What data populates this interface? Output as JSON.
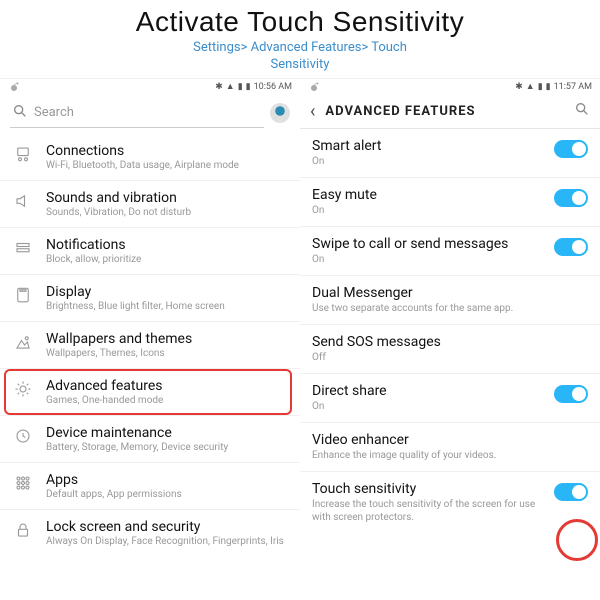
{
  "header": {
    "title": "Activate Touch Sensitivity",
    "breadcrumb_line1": "Settings> Advanced Features> Touch",
    "breadcrumb_line2": "Sensitivity"
  },
  "status_left": {
    "time": "10:56 AM"
  },
  "status_right": {
    "time": "11:57 AM"
  },
  "search_placeholder": "Search",
  "settings": [
    {
      "title": "Connections",
      "sub": "Wi-Fi, Bluetooth, Data usage, Airplane mode",
      "icon": "connections"
    },
    {
      "title": "Sounds and vibration",
      "sub": "Sounds, Vibration, Do not disturb",
      "icon": "sound"
    },
    {
      "title": "Notifications",
      "sub": "Block, allow, prioritize",
      "icon": "notifications"
    },
    {
      "title": "Display",
      "sub": "Brightness, Blue light filter, Home screen",
      "icon": "display"
    },
    {
      "title": "Wallpapers and themes",
      "sub": "Wallpapers, Themes, Icons",
      "icon": "wallpaper"
    },
    {
      "title": "Advanced features",
      "sub": "Games, One-handed mode",
      "icon": "advanced"
    },
    {
      "title": "Device maintenance",
      "sub": "Battery, Storage, Memory, Device security",
      "icon": "maintenance"
    },
    {
      "title": "Apps",
      "sub": "Default apps, App permissions",
      "icon": "apps"
    },
    {
      "title": "Lock screen and security",
      "sub": "Always On Display, Face Recognition, Fingerprints, Iris",
      "icon": "lock"
    }
  ],
  "af_title": "ADVANCED FEATURES",
  "af_items": [
    {
      "title": "Smart alert",
      "sub": "On",
      "toggle": true
    },
    {
      "title": "Easy mute",
      "sub": "On",
      "toggle": true
    },
    {
      "title": "Swipe to call or send messages",
      "sub": "On",
      "toggle": true
    },
    {
      "title": "Dual Messenger",
      "sub": "Use two separate accounts for the same app.",
      "toggle": false
    },
    {
      "title": "Send SOS messages",
      "sub": "Off",
      "toggle": false
    },
    {
      "title": "Direct share",
      "sub": "On",
      "toggle": true
    },
    {
      "title": "Video enhancer",
      "sub": "Enhance the image quality of your videos.",
      "toggle": false
    },
    {
      "title": "Touch sensitivity",
      "sub": "Increase the touch sensitivity of the screen for use with screen protectors.",
      "toggle": true
    }
  ]
}
